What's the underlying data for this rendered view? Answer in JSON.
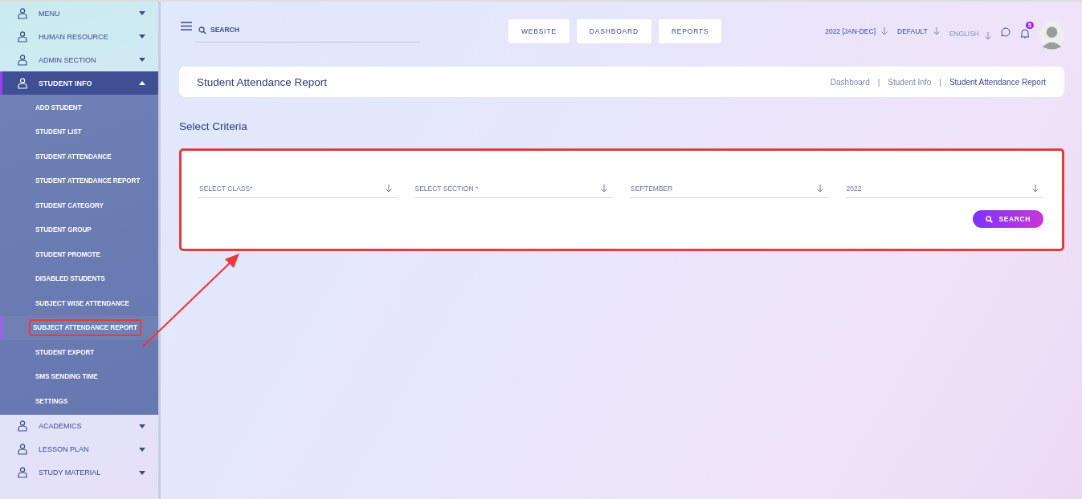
{
  "sidebar": {
    "items": [
      {
        "label": "MENU",
        "expanded": false
      },
      {
        "label": "HUMAN RESOURCE",
        "expanded": false
      },
      {
        "label": "ADMIN SECTION",
        "expanded": false
      },
      {
        "label": "STUDENT INFO",
        "expanded": true,
        "children": [
          {
            "label": "ADD STUDENT",
            "selected": false,
            "highlighted": false
          },
          {
            "label": "STUDENT LIST",
            "selected": false,
            "highlighted": false
          },
          {
            "label": "STUDENT ATTENDANCE",
            "selected": false,
            "highlighted": false
          },
          {
            "label": "STUDENT ATTENDANCE REPORT",
            "selected": false,
            "highlighted": false
          },
          {
            "label": "STUDENT CATEGORY",
            "selected": false,
            "highlighted": false
          },
          {
            "label": "STUDENT GROUP",
            "selected": false,
            "highlighted": false
          },
          {
            "label": "STUDENT PROMOTE",
            "selected": false,
            "highlighted": false
          },
          {
            "label": "DISABLED STUDENTS",
            "selected": false,
            "highlighted": false
          },
          {
            "label": "SUBJECT WISE ATTENDANCE",
            "selected": false,
            "highlighted": false
          },
          {
            "label": "SUBJECT ATTENDANCE REPORT",
            "selected": true,
            "highlighted": true
          },
          {
            "label": "STUDENT EXPORT",
            "selected": false,
            "highlighted": false
          },
          {
            "label": "SMS SENDING TIME",
            "selected": false,
            "highlighted": false
          },
          {
            "label": "SETTINGS",
            "selected": false,
            "highlighted": false
          }
        ]
      },
      {
        "label": "ACADEMICS",
        "expanded": false
      },
      {
        "label": "LESSON PLAN",
        "expanded": false
      },
      {
        "label": "STUDY MATERIAL",
        "expanded": false
      }
    ]
  },
  "topbar": {
    "search": {
      "placeholder": "SEARCH"
    },
    "buttons": [
      "WEBSITE",
      "DASHBOARD",
      "REPORTS"
    ],
    "dropdowns": [
      "2022 [JAN-DEC]",
      "DEFAULT",
      "ENGLISH"
    ],
    "notification_count": "5"
  },
  "page_header": {
    "title": "Student Attendance Report",
    "breadcrumb_separator": "|",
    "breadcrumbs": [
      "Dashboard",
      "Student Info",
      "Student Attendance Report"
    ]
  },
  "criteria": {
    "title": "Select Criteria",
    "highlighted": true,
    "selects": [
      {
        "value": "SELECT CLASS*"
      },
      {
        "value": "SELECT SECTION *"
      },
      {
        "value": "SEPTEMBER"
      },
      {
        "value": "2022"
      }
    ],
    "search_button": "SEARCH"
  }
}
